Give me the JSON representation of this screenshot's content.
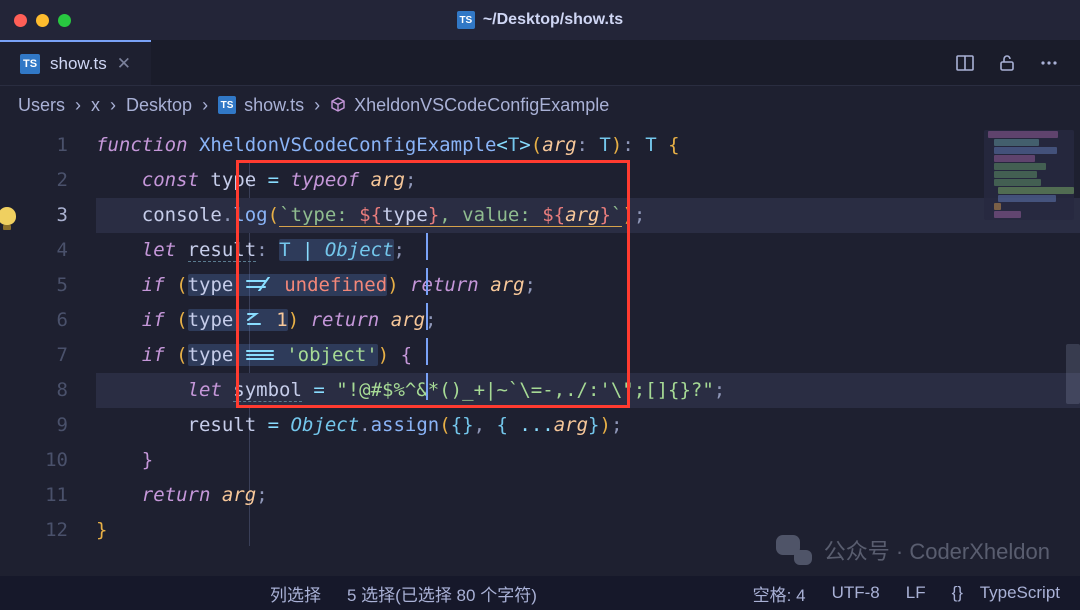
{
  "window": {
    "title": "~/Desktop/show.ts",
    "file_badge": "TS"
  },
  "tab": {
    "label": "show.ts",
    "badge": "TS"
  },
  "tab_actions": {
    "split": "split-editor",
    "lock": "readonly-toggle",
    "more": "more-actions"
  },
  "breadcrumbs": {
    "segments": [
      "Users",
      "x",
      "Desktop",
      "show.ts",
      "XheldonVSCodeConfigExample"
    ]
  },
  "lines": {
    "count": 12,
    "current": 3
  },
  "code": {
    "l1": {
      "kw_function": "function",
      "name": "XheldonVSCodeConfigExample",
      "T": "T",
      "arg": "arg",
      "colon": ":",
      "ret": "T"
    },
    "l2": {
      "kw_const": "const",
      "v": "type",
      "eq": "=",
      "kw_typeof": "typeof",
      "arg": "arg"
    },
    "l3": {
      "obj": "console",
      "method": "log",
      "tpl_a": "type: ",
      "v1": "type",
      "tpl_b": ", value: ",
      "v2": "arg"
    },
    "l4": {
      "kw_let": "let",
      "v": "result",
      "t1": "T",
      "t2": "Object"
    },
    "l5": {
      "kw_if": "if",
      "v": "type",
      "rhs": "undefined",
      "kw_return": "return",
      "arg": "arg"
    },
    "l6": {
      "kw_if": "if",
      "v": "type",
      "num": "1",
      "kw_return": "return",
      "arg": "arg"
    },
    "l7": {
      "kw_if": "if",
      "v": "type",
      "str": "'object'"
    },
    "l8": {
      "kw_let": "let",
      "v": "symbol",
      "str": "\"!@#$%^&*()_+|~`\\=-,./:'\\\";[]{}?\""
    },
    "l9": {
      "v": "result",
      "obj": "Object",
      "method": "assign",
      "arg": "arg"
    },
    "l10": {},
    "l11": {
      "kw_return": "return",
      "arg": "arg"
    }
  },
  "watermark": {
    "label": "公众号",
    "sep": "·",
    "name": "CoderXheldon"
  },
  "statusbar": {
    "col_select": "列选择",
    "selection": "5 选择(已选择 80 个字符)",
    "spaces": "空格: 4",
    "encoding": "UTF-8",
    "eol": "LF",
    "lang_icon": "{}",
    "language": "TypeScript"
  }
}
